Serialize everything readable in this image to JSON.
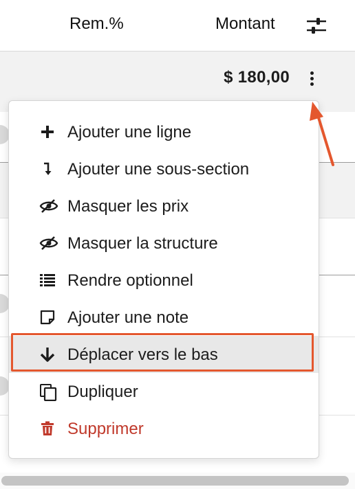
{
  "header": {
    "rem_label": "Rem.%",
    "montant_label": "Montant",
    "settings_icon": "sliders-icon"
  },
  "section": {
    "amount": "$ 180,00",
    "more_icon": "kebab-icon"
  },
  "menu": {
    "items": [
      {
        "label": "Ajouter une ligne",
        "icon": "plus-icon"
      },
      {
        "label": "Ajouter une sous-section",
        "icon": "subsection-arrow-icon"
      },
      {
        "label": "Masquer les prix",
        "icon": "eye-slash-icon"
      },
      {
        "label": "Masquer la structure",
        "icon": "eye-slash-icon"
      },
      {
        "label": "Rendre optionnel",
        "icon": "list-icon"
      },
      {
        "label": "Ajouter une note",
        "icon": "note-icon"
      },
      {
        "label": "Déplacer vers le bas",
        "icon": "arrow-down-icon"
      },
      {
        "label": "Dupliquer",
        "icon": "copy-icon"
      },
      {
        "label": "Supprimer",
        "icon": "trash-icon"
      }
    ],
    "highlighted_index": 6
  },
  "colors": {
    "annotation": "#e4572e",
    "danger": "#c0392b",
    "highlight_bg": "#e8e8e8"
  }
}
